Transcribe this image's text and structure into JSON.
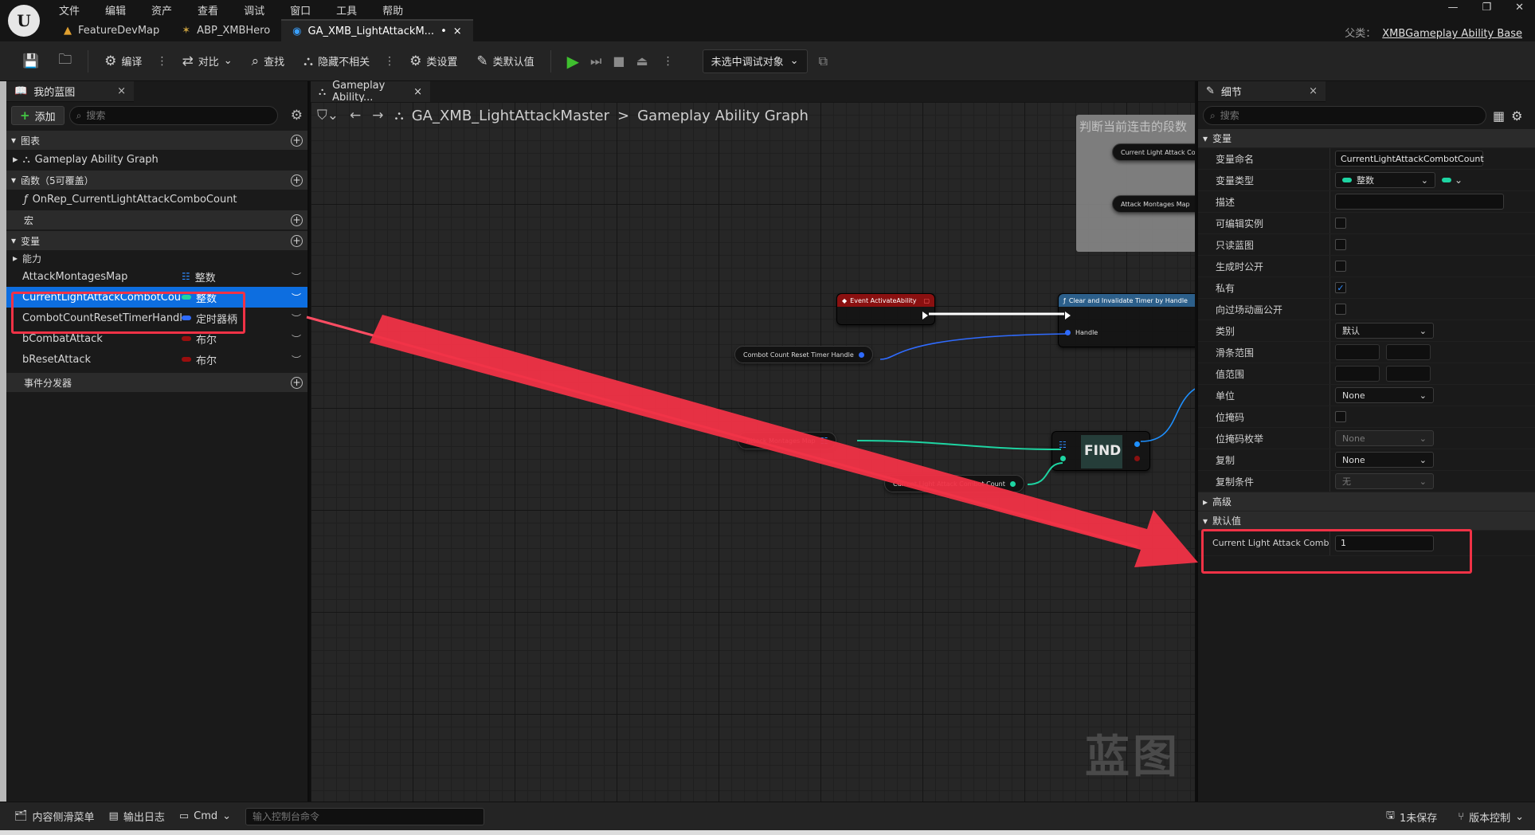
{
  "menubar": [
    "文件",
    "编辑",
    "资产",
    "查看",
    "调试",
    "窗口",
    "工具",
    "帮助"
  ],
  "doc_tabs": [
    {
      "label": "FeatureDevMap",
      "icon": "▲"
    },
    {
      "label": "ABP_XMBHero",
      "icon": "✶"
    },
    {
      "label": "GA_XMB_LightAttackM...",
      "icon": "◉",
      "modified": "•",
      "close": "×"
    }
  ],
  "parent": {
    "label": "父类：",
    "value": "XMBGameplay Ability Base"
  },
  "window_buttons": [
    "—",
    "❐",
    "✕"
  ],
  "toolbar": {
    "compile": "编译",
    "diff": "对比",
    "find": "查找",
    "hide_unrelated": "隐藏不相关",
    "class_settings": "类设置",
    "class_defaults": "类默认值",
    "debug_target": "未选中调试对象"
  },
  "my_blueprint": {
    "tab_label": "我的蓝图",
    "add_label": "添加",
    "search_placeholder": "搜索",
    "graphs_header": "图表",
    "graph_item": "Gameplay Ability Graph",
    "functions_header": "函数（5可覆盖）",
    "function_item": "OnRep_CurrentLightAttackComboCount",
    "macros_header": "宏",
    "variables_header": "变量",
    "category_ability": "能力",
    "variables": [
      {
        "name": "AttackMontagesMap",
        "type": "整数",
        "color": "#2f8bff"
      },
      {
        "name": "CurrentLightAttackCombotCount",
        "type": "整数",
        "color": "#1ed4a2"
      },
      {
        "name": "CombotCountResetTimerHandle",
        "type": "定时器柄",
        "color": "#2f6bff"
      },
      {
        "name": "bCombatAttack",
        "type": "布尔",
        "color": "#9a0e0e"
      },
      {
        "name": "bResetAttack",
        "type": "布尔",
        "color": "#9a0e0e"
      }
    ],
    "event_dispatchers_header": "事件分发器"
  },
  "graph": {
    "tab_label": "Gameplay Ability...",
    "breadcrumb_root": "GA_XMB_LightAttackMaster",
    "breadcrumb_sep": ">",
    "breadcrumb_leaf": "Gameplay Ability Graph",
    "watermark": "蓝图",
    "comment_title": "判断当前连击的段数",
    "nodes": {
      "comment_var1": "Current Light Attack Com",
      "comment_var2": "Attack Montages Map",
      "event_activate": "Event ActivateAbility",
      "clear_timer": "Clear and Invalidate Timer by Handle",
      "handle_pin": "Handle",
      "timer_handle_var": "Combot Count Reset Timer Handle",
      "attack_map_var": "Attack Montages Map",
      "find": "FIND",
      "combo_count_var": "Current Light Attack Combot Count"
    }
  },
  "details": {
    "tab_label": "细节",
    "search_placeholder": "搜索",
    "variable_section": "变量",
    "rows": {
      "var_name_label": "变量命名",
      "var_name_value": "CurrentLightAttackCombotCount",
      "var_type_label": "变量类型",
      "var_type_value": "整数",
      "description_label": "描述",
      "editable_label": "可编辑实例",
      "readonly_label": "只读蓝图",
      "expose_label": "生成时公开",
      "private_label": "私有",
      "expose_cinematics_label": "向过场动画公开",
      "category_label": "类别",
      "category_value": "默认",
      "slider_label": "滑条范围",
      "value_range_label": "值范围",
      "units_label": "单位",
      "units_value": "None",
      "bitmask_label": "位掩码",
      "bitmask_enum_label": "位掩码枚举",
      "bitmask_enum_value": "None",
      "replication_label": "复制",
      "replication_value": "None",
      "rep_condition_label": "复制条件",
      "rep_condition_value": "无"
    },
    "advanced_section": "高级",
    "default_section": "默认值",
    "default_label": "Current Light Attack Comb...",
    "default_value": "1"
  },
  "statusbar": {
    "content_drawer": "内容侧滑菜单",
    "output_log": "输出日志",
    "cmd": "Cmd",
    "cmd_placeholder": "输入控制台命令",
    "unsaved": "1未保存",
    "source_control": "版本控制"
  },
  "colors": {
    "highlight": "#f03246",
    "selection": "#0d6ee0",
    "integer_pin": "#1ed4a2",
    "event_header": "#8a1010",
    "function_header": "#2c5f8a"
  }
}
